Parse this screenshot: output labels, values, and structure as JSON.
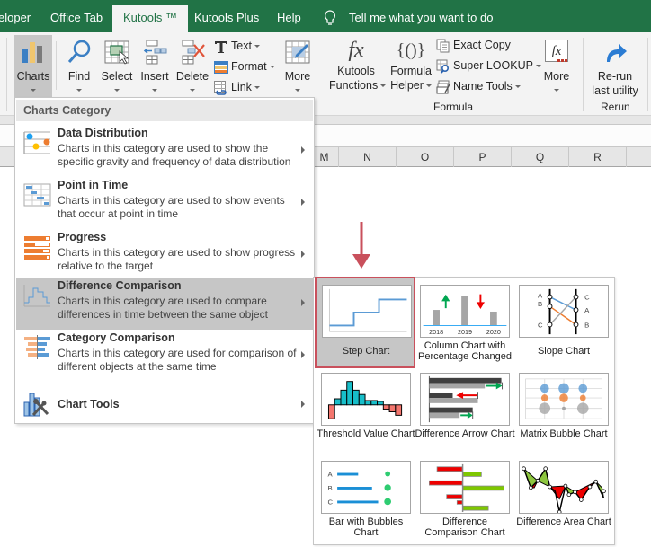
{
  "tabs": [
    {
      "label": "eloper",
      "active": false
    },
    {
      "label": "Office Tab",
      "active": false
    },
    {
      "label": "Kutools ™",
      "active": true
    },
    {
      "label": "Kutools Plus",
      "active": false
    },
    {
      "label": "Help",
      "active": false
    }
  ],
  "tell_me": "Tell me what you want to do",
  "ribbon": {
    "charts": "Charts",
    "find": "Find",
    "select": "Select",
    "insert": "Insert",
    "delete": "Delete",
    "text": "Text",
    "format": "Format",
    "link": "Link",
    "more1": "More",
    "kutools_functions_1": "Kutools",
    "kutools_functions_2": "Functions",
    "formula_helper_1": "Formula",
    "formula_helper_2": "Helper",
    "exact_copy": "Exact Copy",
    "super_lookup": "Super LOOKUP",
    "name_tools": "Name Tools",
    "more2": "More",
    "rerun_1": "Re-run",
    "rerun_2": "last utility",
    "group_formula": "Formula",
    "group_rerun": "Rerun"
  },
  "columns": [
    "M",
    "N",
    "O",
    "P",
    "Q",
    "R"
  ],
  "menu": {
    "header": "Charts Category",
    "items": [
      {
        "title": "Data Distribution",
        "desc": "Charts in this category are used to show the specific gravity and frequency of data distribution",
        "icon": "data-distribution-icon"
      },
      {
        "title": "Point in Time",
        "desc": "Charts in this category are used to show events that occur at point in time",
        "icon": "point-in-time-icon"
      },
      {
        "title": "Progress",
        "desc": "Charts in this category are used to show progress relative to the target",
        "icon": "progress-icon"
      },
      {
        "title": "Difference Comparison",
        "desc": "Charts in this category are used to compare differences in time between the same object",
        "icon": "difference-comparison-icon",
        "highlighted": true
      },
      {
        "title": "Category Comparison",
        "desc": "Charts in this category are used for comparison of different objects at the same time",
        "icon": "category-comparison-icon"
      },
      {
        "title": "Chart Tools",
        "desc": "",
        "icon": "chart-tools-icon"
      }
    ]
  },
  "gallery": {
    "items": [
      {
        "label": "Step Chart",
        "selected": true
      },
      {
        "label": "Column Chart with Percentage Changed",
        "years": [
          "2018",
          "2019",
          "2020"
        ]
      },
      {
        "label": "Slope Chart",
        "left_letters": [
          "A",
          "B",
          "C"
        ],
        "right_letters": [
          "C",
          "A",
          "B"
        ]
      },
      {
        "label": "Threshold Value Chart"
      },
      {
        "label": "Difference Arrow Chart"
      },
      {
        "label": "Matrix Bubble Chart"
      },
      {
        "label": "Bar with Bubbles Chart",
        "letters": [
          "A",
          "B",
          "C"
        ]
      },
      {
        "label": "Difference Comparison Chart"
      },
      {
        "label": "Difference Area Chart"
      }
    ]
  },
  "colors": {
    "excel_green": "#217346",
    "highlight_red": "#c9505c",
    "menu_highlight": "#c6c6c6"
  }
}
